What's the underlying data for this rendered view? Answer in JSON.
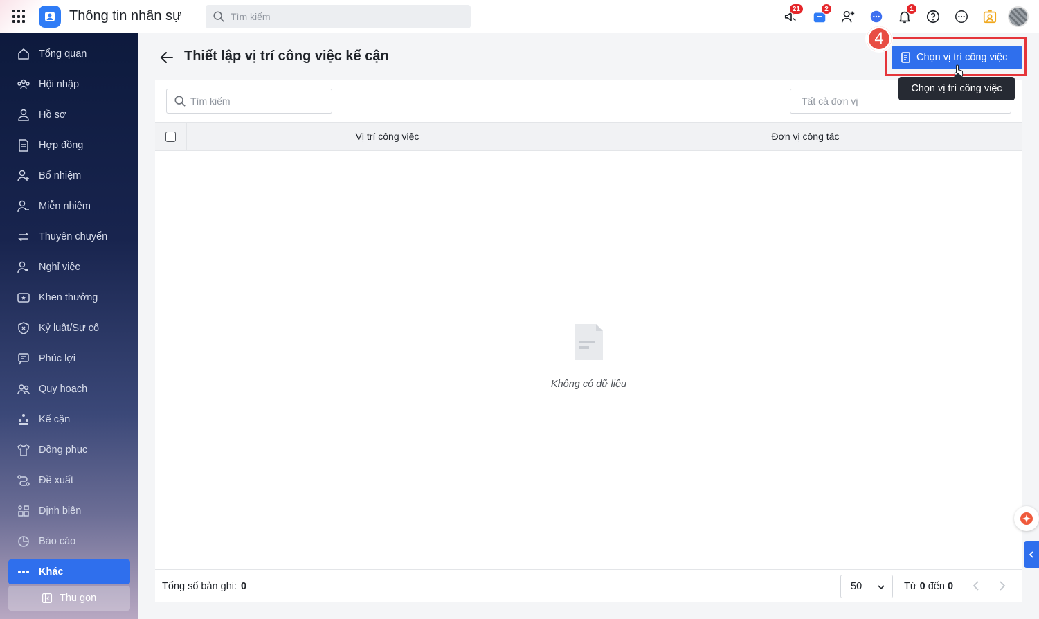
{
  "app": {
    "title": "Thông tin nhân sự"
  },
  "top_search": {
    "placeholder": "Tìm kiếm"
  },
  "top_badges": {
    "announce": "21",
    "cart": "2",
    "bell": "1"
  },
  "sidebar": {
    "items": [
      {
        "label": "Tổng quan",
        "icon": "home-icon"
      },
      {
        "label": "Hội nhập",
        "icon": "people-icon"
      },
      {
        "label": "Hồ sơ",
        "icon": "user-icon"
      },
      {
        "label": "Hợp đồng",
        "icon": "contract-icon"
      },
      {
        "label": "Bổ nhiệm",
        "icon": "user-plus-icon"
      },
      {
        "label": "Miễn nhiệm",
        "icon": "user-minus-icon"
      },
      {
        "label": "Thuyên chuyển",
        "icon": "transfer-icon"
      },
      {
        "label": "Nghỉ việc",
        "icon": "user-x-icon"
      },
      {
        "label": "Khen thưởng",
        "icon": "reward-icon"
      },
      {
        "label": "Kỷ luật/Sự cố",
        "icon": "shield-icon"
      },
      {
        "label": "Phúc lợi",
        "icon": "benefit-icon"
      },
      {
        "label": "Quy hoạch",
        "icon": "planning-icon"
      },
      {
        "label": "Kế cận",
        "icon": "succession-icon"
      },
      {
        "label": "Đồng phục",
        "icon": "shirt-icon"
      },
      {
        "label": "Đề xuất",
        "icon": "proposal-icon"
      },
      {
        "label": "Định biên",
        "icon": "headcount-icon"
      },
      {
        "label": "Báo cáo",
        "icon": "report-icon"
      }
    ],
    "active": {
      "label": "Khác"
    },
    "collapse": {
      "label": "Thu gọn"
    }
  },
  "page": {
    "title": "Thiết lập vị trí công việc kế cận",
    "step": "4",
    "primary_button": "Chọn vị trí công việc",
    "tooltip": "Chọn vị trí công việc"
  },
  "filters": {
    "search_placeholder": "Tìm kiếm",
    "unit_select": "Tất cả đơn vị"
  },
  "table": {
    "columns": [
      "Vị trí công việc",
      "Đơn vị công tác"
    ],
    "rows": [],
    "empty_text": "Không có dữ liệu"
  },
  "footer": {
    "total_label": "Tổng số bản ghi:",
    "total_value": "0",
    "page_size": "50",
    "range_from_label": "Từ",
    "range_from": "0",
    "range_to_label": "đến",
    "range_to": "0"
  },
  "colors": {
    "primary": "#2f6fed",
    "danger": "#e5262a",
    "step": "#e84d43"
  }
}
